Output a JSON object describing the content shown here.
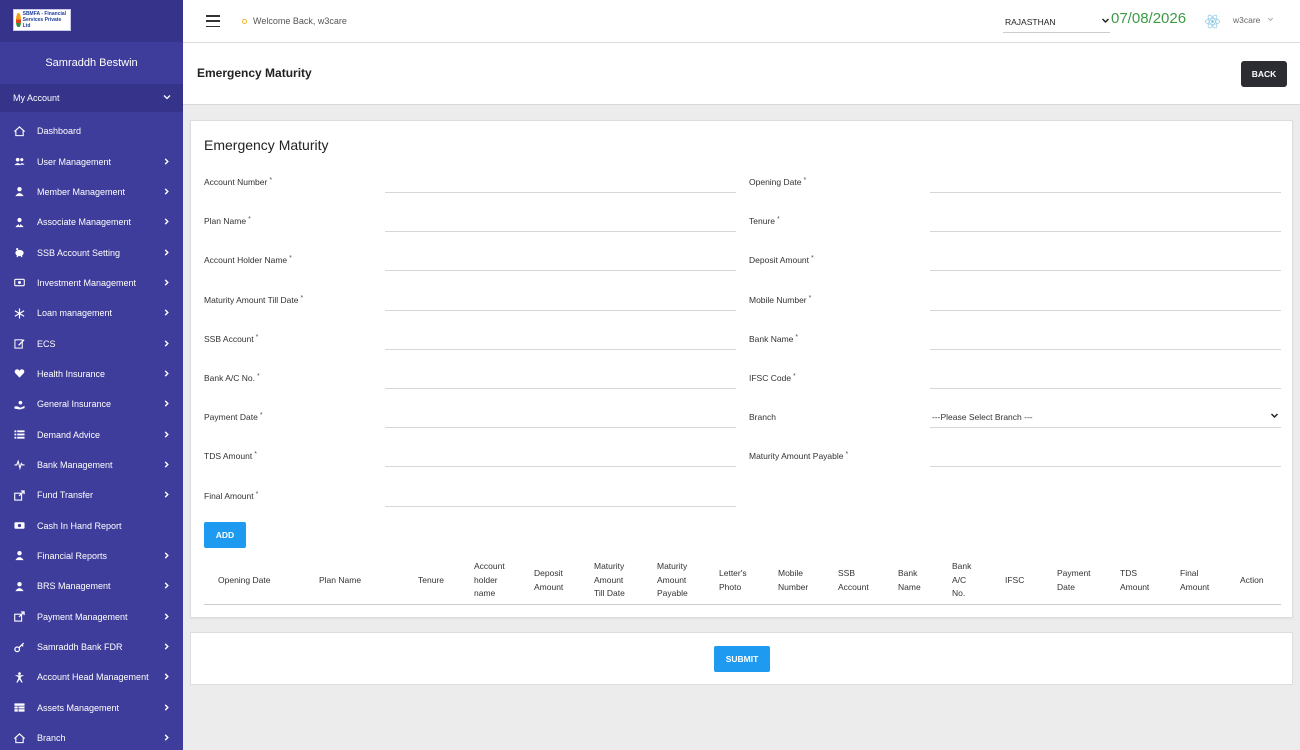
{
  "sidebar": {
    "logo_text": "SBMFA - Financial Services Private Ltd",
    "org_name": "Samraddh Bestwin",
    "account_label": "My Account",
    "items": [
      {
        "label": "Dashboard",
        "icon": "home-icon",
        "arrow": false
      },
      {
        "label": "User Management",
        "icon": "users-icon",
        "arrow": true
      },
      {
        "label": "Member Management",
        "icon": "user-icon",
        "arrow": true
      },
      {
        "label": "Associate Management",
        "icon": "user-tie-icon",
        "arrow": true
      },
      {
        "label": "SSB Account Setting",
        "icon": "piggy-bank-icon",
        "arrow": true
      },
      {
        "label": "Investment Management",
        "icon": "money-icon",
        "arrow": true
      },
      {
        "label": "Loan management",
        "icon": "snowflake-icon",
        "arrow": true
      },
      {
        "label": "ECS",
        "icon": "edit-icon",
        "arrow": true
      },
      {
        "label": "Health Insurance",
        "icon": "heart-icon",
        "arrow": true
      },
      {
        "label": "General Insurance",
        "icon": "hand-icon",
        "arrow": true
      },
      {
        "label": "Demand Advice",
        "icon": "list-icon",
        "arrow": true
      },
      {
        "label": "Bank Management",
        "icon": "pulse-icon",
        "arrow": true
      },
      {
        "label": "Fund Transfer",
        "icon": "share-icon",
        "arrow": true
      },
      {
        "label": "Cash In Hand Report",
        "icon": "cash-icon",
        "arrow": false
      },
      {
        "label": "Financial Reports",
        "icon": "user-icon",
        "arrow": true
      },
      {
        "label": "BRS Management",
        "icon": "user-icon",
        "arrow": true
      },
      {
        "label": "Payment Management",
        "icon": "share-icon",
        "arrow": true
      },
      {
        "label": "Samraddh Bank FDR",
        "icon": "key-icon",
        "arrow": true
      },
      {
        "label": "Account Head Management",
        "icon": "person-arms-icon",
        "arrow": true
      },
      {
        "label": "Assets Management",
        "icon": "table-icon",
        "arrow": true
      },
      {
        "label": "Branch",
        "icon": "home-icon",
        "arrow": true
      }
    ]
  },
  "topbar": {
    "welcome": "Welcome Back, w3care",
    "state": "RAJASTHAN",
    "date": "07/08/2026",
    "user": "w3care"
  },
  "header": {
    "title": "Emergency Maturity",
    "back_label": "BACK"
  },
  "form": {
    "title": "Emergency Maturity",
    "left_fields": [
      {
        "label": "Account Number",
        "required": "*"
      },
      {
        "label": "Plan Name",
        "required": "*"
      },
      {
        "label": "Account Holder Name",
        "required": "*"
      },
      {
        "label": "Maturity Amount Till Date",
        "required": "*"
      },
      {
        "label": "SSB Account",
        "required": "*"
      },
      {
        "label": "Bank A/C No.",
        "required": "*"
      },
      {
        "label": "Payment Date",
        "required": "*"
      },
      {
        "label": "TDS Amount",
        "required": "*"
      },
      {
        "label": "Final Amount",
        "required": "*"
      }
    ],
    "right_fields": [
      {
        "label": "Opening Date",
        "required": "*"
      },
      {
        "label": "Tenure",
        "required": "*"
      },
      {
        "label": "Deposit Amount",
        "required": "*"
      },
      {
        "label": "Mobile Number",
        "required": "*"
      },
      {
        "label": "Bank Name",
        "required": "*"
      },
      {
        "label": "IFSC Code",
        "required": "*"
      },
      {
        "label": "Branch",
        "required": ""
      },
      {
        "label": "Maturity Amount Payable",
        "required": "*"
      }
    ],
    "branch_placeholder": "---Please Select Branch ---",
    "add_label": "ADD"
  },
  "table": {
    "headers": [
      [
        "Opening Date"
      ],
      [
        "Plan Name"
      ],
      [
        "Tenure"
      ],
      [
        "Account",
        "holder",
        "name"
      ],
      [
        "Deposit",
        "Amount"
      ],
      [
        "Maturity",
        "Amount",
        "Till Date"
      ],
      [
        "Maturity",
        "Amount",
        "Payable"
      ],
      [
        "Letter's",
        "Photo"
      ],
      [
        "Mobile",
        "Number"
      ],
      [
        "SSB",
        "Account"
      ],
      [
        "Bank",
        "Name"
      ],
      [
        "Bank",
        "A/C",
        "No."
      ],
      [
        "IFSC"
      ],
      [
        "Payment",
        "Date"
      ],
      [
        "TDS",
        "Amount"
      ],
      [
        "Final",
        "Amount"
      ],
      [
        "Action"
      ]
    ]
  },
  "submit_label": "SUBMIT",
  "colors": {
    "sidebar_bg": "#3f3d9b",
    "primary_button": "#1e9bf0",
    "date_green": "#3d9b46",
    "back_button": "#2b2d33"
  }
}
